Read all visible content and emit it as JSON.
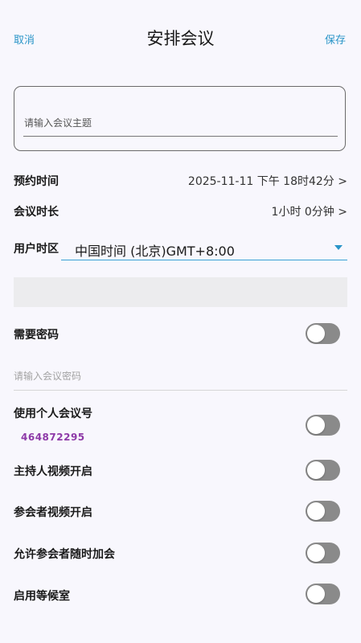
{
  "header": {
    "cancel": "取消",
    "title": "安排会议",
    "save": "保存"
  },
  "subject": {
    "placeholder": "请输入会议主题",
    "value": ""
  },
  "schedule": {
    "label": "预约时间",
    "value": "2025-11-11 下午 18时42分 >"
  },
  "duration": {
    "label": "会议时长",
    "value": "1小时 0分钟 >"
  },
  "timezone": {
    "label": "用户时区",
    "value": "中国时间 (北京)GMT+8:00"
  },
  "password": {
    "label": "需要密码",
    "placeholder": "请输入会议密码",
    "enabled": false
  },
  "personal_meeting": {
    "label": "使用个人会议号",
    "number": "464872295",
    "enabled": false
  },
  "host_video": {
    "label": "主持人视频开启",
    "enabled": false
  },
  "participant_video": {
    "label": "参会者视频开启",
    "enabled": false
  },
  "join_anytime": {
    "label": "允许参会者随时加会",
    "enabled": false
  },
  "waiting_room": {
    "label": "启用等候室",
    "enabled": false
  },
  "colors": {
    "accent": "#2a95c8",
    "meeting_number": "#8e3aa8",
    "toggle_off": "#8a8a8a"
  }
}
